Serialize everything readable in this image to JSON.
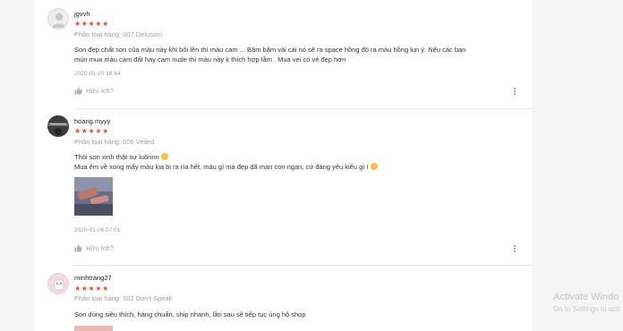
{
  "reviews": [
    {
      "username": "jgvvh",
      "rating": 5,
      "stars": "★★★★★",
      "variation": "Phân loại hàng: 007 Delusion",
      "comment_lines": [
        "Son đẹp chất son của màu này khi bôi lên thì màu cam ... Bặm bặm vài cái nó sẽ ra space hồng đỏ ra màu hồng lun ý. Nếu các bạn",
        "mún mua màu cam đất hay cam nude thì màu này k thích hợp lắm . Mua vei có vẻ đẹp hơn"
      ],
      "date": "2020-01-15 18:44",
      "helpful_label": "Hữu ích?"
    },
    {
      "username": "hoang.myyy",
      "rating": 5,
      "stars": "★★★★★",
      "variation": "Phân loại hàng: 006 Veiled",
      "comment_lines": [
        "Thỏi son xinh thật sự luônnn",
        "Mua ếm về xong mấy màu kia bị ra rìa hết, màu gì mà đẹp dã man con ngan, cứ đáng yêu kiểu gì í"
      ],
      "date": "2020-01-06 07:01",
      "helpful_label": "Hữu Ích?"
    },
    {
      "username": "minhtrang27",
      "rating": 5,
      "stars": "★★★★★",
      "variation": "Phân loại hàng: 002 Don't Speak",
      "comment_lines": [
        "Son dùng siêu thích, hàng chuẩn, ship nhanh, lần sau sẽ tiếp tục ủng hộ shop"
      ]
    }
  ],
  "watermark": {
    "title": "Activate Windo",
    "subtitle": "Go to Settings to acti"
  },
  "colors": {
    "star": "#ee4d2d",
    "muted": "#a0a0a0",
    "text": "#333333"
  },
  "icons": {
    "helpful": "thumb-up-icon",
    "more": "more-vertical-icon",
    "avatar_default": "user-icon"
  }
}
